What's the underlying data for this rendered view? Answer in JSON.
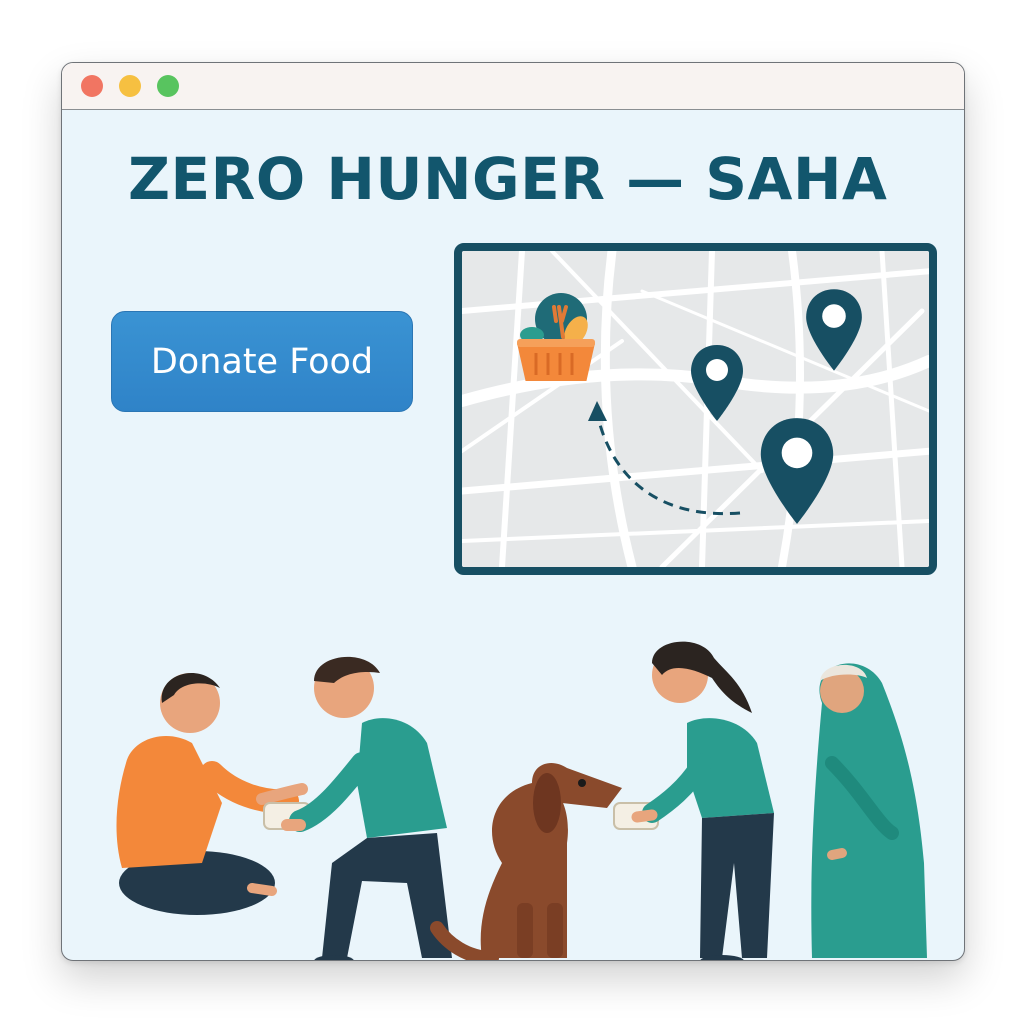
{
  "window": {
    "controls": [
      "close",
      "minimize",
      "maximize"
    ]
  },
  "header": {
    "title": "ZERO HUNGER — SAHA"
  },
  "actions": {
    "donate_label": "Donate Food"
  },
  "map": {
    "icons": [
      "food-basket-icon",
      "map-pin-icon",
      "map-pin-icon",
      "map-pin-icon",
      "route-arrow-icon"
    ]
  },
  "illustration": {
    "figures": [
      "seated-person",
      "volunteer-kneeling",
      "dog",
      "volunteer-woman",
      "elderly-woman"
    ]
  },
  "colors": {
    "title": "#12566d",
    "button": "#3a93d3",
    "map_border": "#174f63",
    "accent_teal": "#2a9d8f",
    "accent_orange": "#f3883a"
  }
}
